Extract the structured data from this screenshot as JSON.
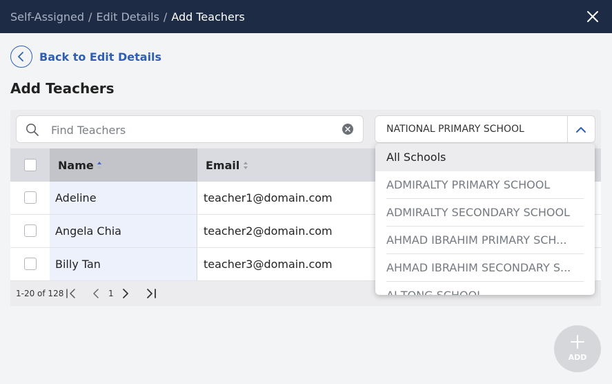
{
  "breadcrumb": {
    "items": [
      "Self-Assigned",
      "Edit Details",
      "Add Teachers"
    ],
    "separator": "/"
  },
  "back_link": "Back to Edit Details",
  "page_title": "Add Teachers",
  "search": {
    "placeholder": "Find Teachers",
    "value": ""
  },
  "school_select": {
    "value": "NATIONAL PRIMARY SCHOOL",
    "options": [
      "All Schools",
      "ADMIRALTY PRIMARY SCHOOL",
      "ADMIRALTY SECONDARY SCHOOL",
      "AHMAD IBRAHIM PRIMARY SCH...",
      "AHMAD IBRAHIM SECONDARY S...",
      "AI TONG SCHOOL"
    ]
  },
  "table": {
    "columns": [
      "Name",
      "Email"
    ],
    "rows": [
      {
        "name": "Adeline",
        "email": "teacher1@domain.com"
      },
      {
        "name": "Angela Chia",
        "email": "teacher2@domain.com"
      },
      {
        "name": "Billy Tan",
        "email": "teacher3@domain.com"
      }
    ]
  },
  "pagination": {
    "range": "1-20 of 128",
    "page": "1"
  },
  "add_button": {
    "label": "ADD"
  },
  "colors": {
    "header_bg": "#1d2b45",
    "accent": "#2f5fb5",
    "sort_active": "#3d63c4"
  }
}
